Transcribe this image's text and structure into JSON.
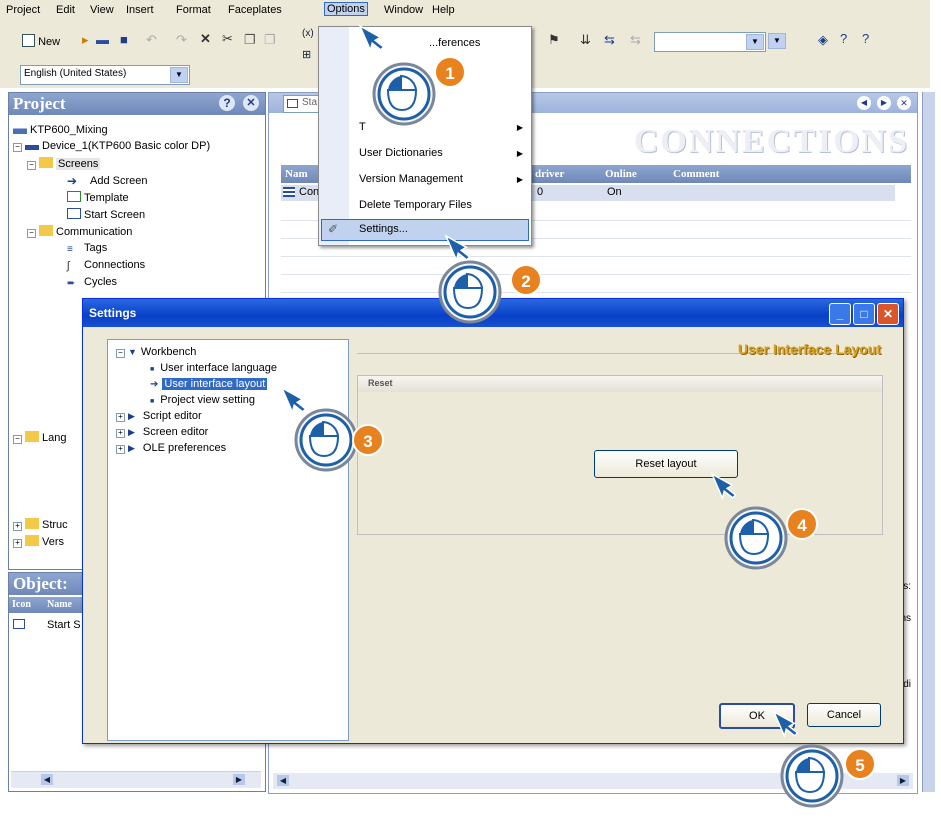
{
  "menubar": {
    "items": [
      "Project",
      "Edit",
      "View",
      "Insert",
      "Format",
      "Faceplates",
      "Options",
      "Window",
      "Help"
    ]
  },
  "toolbar": {
    "new_label": "New",
    "language_combo": "English (United States)"
  },
  "project_panel": {
    "title": "Project",
    "tree": [
      "KTP600_Mixing",
      "Device_1(KTP600 Basic color DP)",
      "Screens",
      "Add Screen",
      "Template",
      "Start Screen",
      "Communication",
      "Tags",
      "Connections",
      "Cycles",
      "Lang",
      "Struc",
      "Vers"
    ]
  },
  "object_panel": {
    "title": "Object:",
    "col_icon": "Icon",
    "col_name": "Name",
    "row1": "Start S"
  },
  "editor": {
    "tab": "Sta",
    "title": "CONNECTIONS",
    "col_name": "Nam",
    "col_driver": "driver",
    "col_online": "Online",
    "col_comment": "Comment",
    "row_name": "Con",
    "row_driver": "0",
    "row_online": "On",
    "side_fragments": [
      "es:",
      "hs",
      "di"
    ]
  },
  "options_menu": {
    "items": [
      {
        "label": "...ferences",
        "has_submenu": false
      },
      {
        "label": "T",
        "has_submenu": true
      },
      {
        "label": "User Dictionaries",
        "has_submenu": true
      },
      {
        "label": "Version Management",
        "has_submenu": true
      },
      {
        "label": "Delete Temporary Files",
        "has_submenu": false
      },
      {
        "label": "Settings...",
        "has_submenu": false
      }
    ]
  },
  "settings_dialog": {
    "title": "Settings",
    "tree": {
      "workbench": "Workbench",
      "ui_language": "User interface language",
      "ui_layout": "User interface layout",
      "project_view": "Project view setting",
      "script_editor": "Script editor",
      "screen_editor": "Screen editor",
      "ole_preferences": "OLE preferences"
    },
    "section_title": "User Interface Layout",
    "group_title": "Reset",
    "reset_button": "Reset layout",
    "ok_button": "OK",
    "cancel_button": "Cancel"
  },
  "steps": [
    "1",
    "2",
    "3",
    "4",
    "5"
  ],
  "colors": {
    "accent_orange": "#e8821e",
    "callout_blue": "#1d5fa8",
    "xp_title_blue": "#0840c8",
    "section_title": "#d9a020"
  }
}
